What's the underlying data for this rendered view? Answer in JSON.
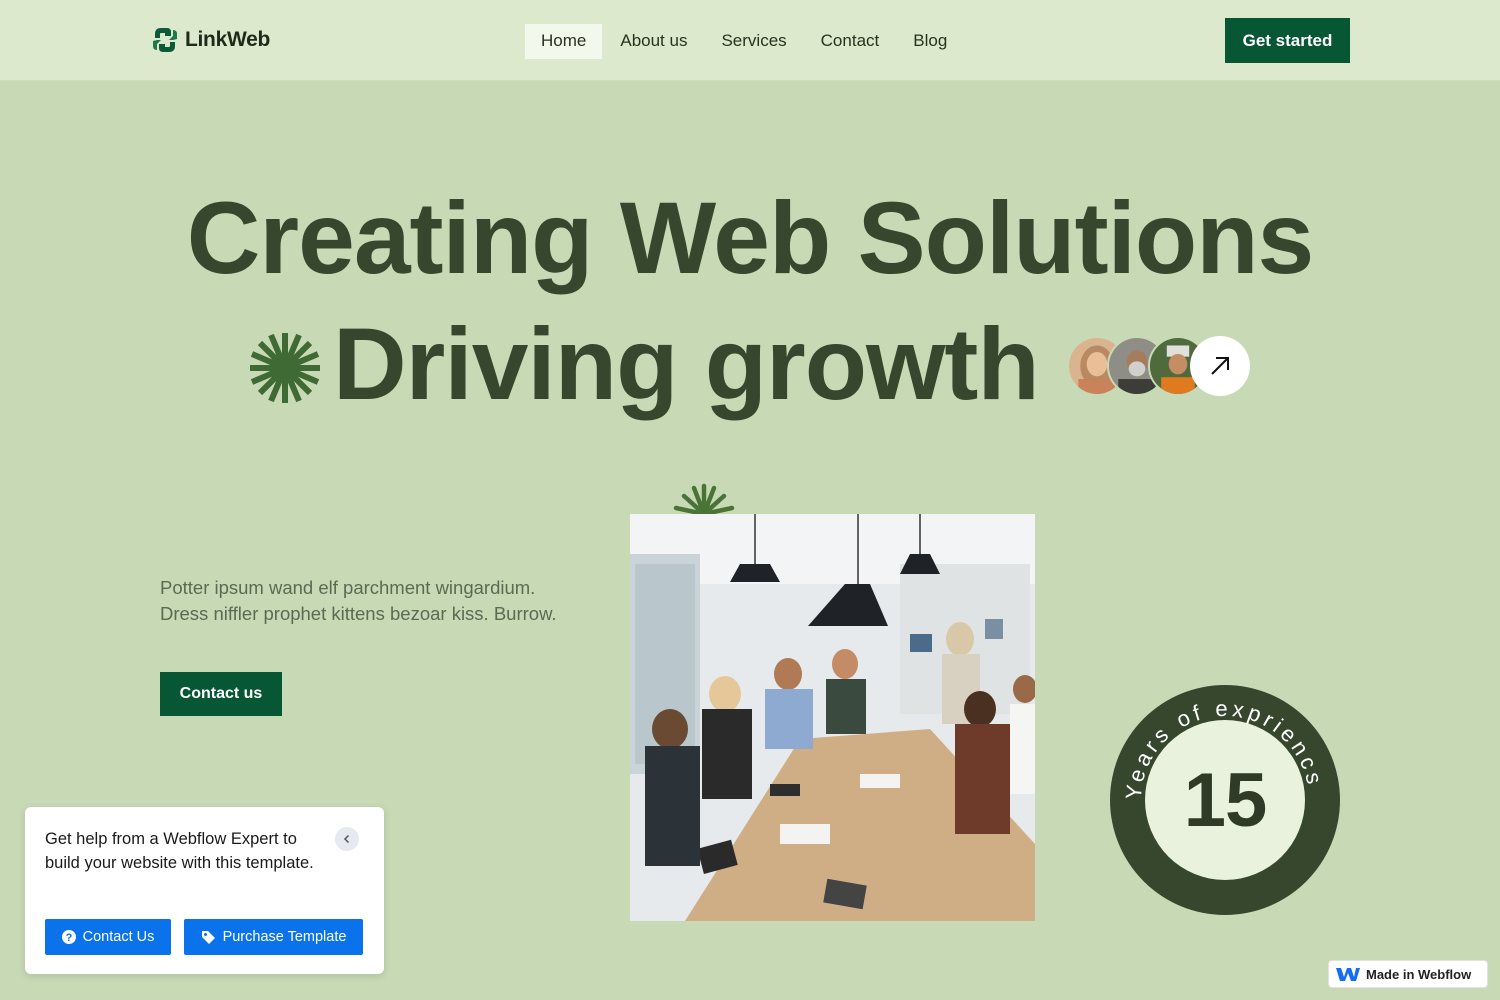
{
  "nav": {
    "logo_text": "LinkWeb",
    "links": [
      {
        "label": "Home",
        "active": true
      },
      {
        "label": "About us"
      },
      {
        "label": "Services"
      },
      {
        "label": "Contact"
      },
      {
        "label": "Blog"
      }
    ],
    "cta_label": "Get started"
  },
  "hero": {
    "line1": "Creating Web Solutions",
    "line2": "Driving growth",
    "icons": [
      "sparkle-burst-icon",
      "arrow-up-right-icon"
    ]
  },
  "intro": {
    "text": "Potter ipsum wand elf parchment wingardium. Dress niffler prophet kittens bezoar kiss. Burrow.",
    "button_label": "Contact us"
  },
  "badge": {
    "number": "15",
    "ring_text": "Years of expriencs"
  },
  "help_card": {
    "text": "Get help from a Webflow Expert to build your website with this template.",
    "contact_label": "Contact Us",
    "purchase_label": "Purchase Template"
  },
  "made_in_webflow": "Made in Webflow",
  "colors": {
    "background": "#c8d9b6",
    "nav_background": "#dde9cc",
    "brand_green": "#075634",
    "heading": "#37472e",
    "help_blue": "#0a73eb"
  }
}
